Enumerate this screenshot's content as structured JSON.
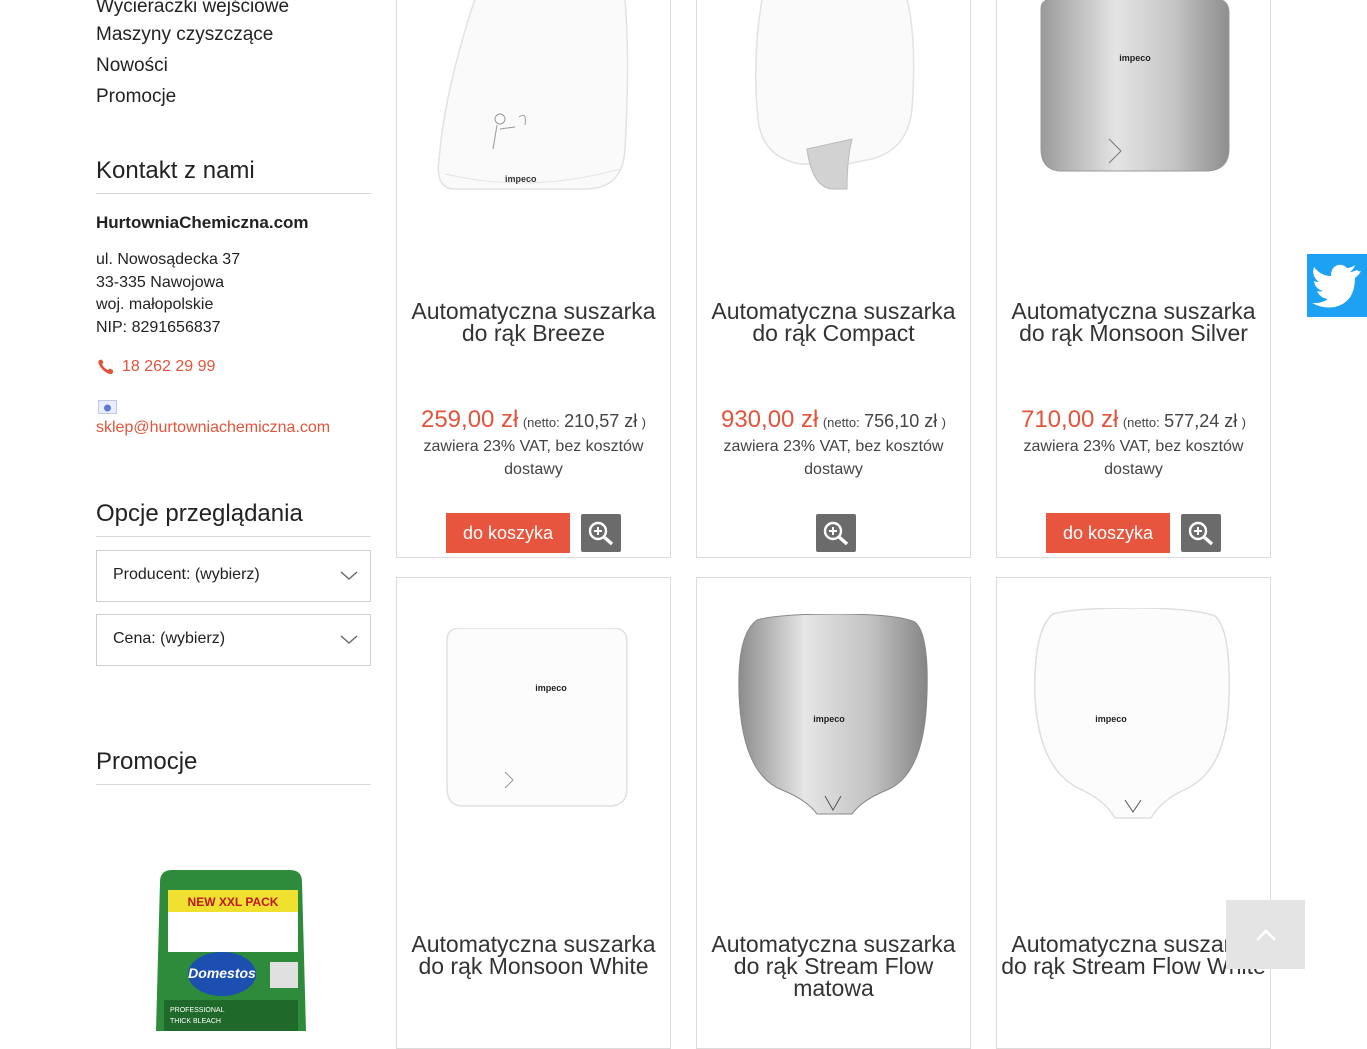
{
  "sidebar": {
    "links": [
      "Wycieraczki wejściowe",
      "Maszyny czyszczące",
      "Nowości",
      "Promocje"
    ],
    "contact": {
      "heading": "Kontakt z nami",
      "company": "HurtowniaChemiczna.com",
      "address1": "ul. Nowosądecka 37",
      "address2": "33-335 Nawojowa",
      "address3": "woj. małopolskie",
      "nip": "NIP: 8291656837",
      "phone": "18 262 29 99",
      "email": "sklep@hurtowniachemiczna.com"
    },
    "browse": {
      "heading": "Opcje przeglądania",
      "producer": "Producent: (wybierz)",
      "price": "Cena: (wybierz)"
    },
    "promo": {
      "heading": "Promocje",
      "product_brand": "Domestos",
      "badge": "NEW XXL PACK",
      "label_small": "PROFESSIONAL",
      "label_small2": "THICK BLEACH"
    }
  },
  "products": [
    {
      "title": "Automatyczna suszarka do rąk Breeze",
      "price": "259,00 zł",
      "netto_label": "(netto:",
      "netto": "210,57 zł",
      "close": ")",
      "vat": "zawiera 23% VAT, bez kosztów dostawy",
      "cart": "do koszyka",
      "brand": "impeco"
    },
    {
      "title": "Automatyczna suszarka do rąk Compact",
      "price": "930,00 zł",
      "netto_label": "(netto:",
      "netto": "756,10 zł",
      "close": ")",
      "vat": "zawiera 23% VAT, bez kosztów dostawy",
      "cart": "",
      "brand": ""
    },
    {
      "title": "Automatyczna suszarka do rąk Monsoon Silver",
      "price": "710,00 zł",
      "netto_label": "(netto:",
      "netto": "577,24 zł",
      "close": ")",
      "vat": "zawiera 23% VAT, bez kosztów dostawy",
      "cart": "do koszyka",
      "brand": "impeco"
    },
    {
      "title": "Automatyczna suszarka do rąk Monsoon White",
      "brand": "impeco"
    },
    {
      "title": "Automatyczna suszarka do rąk Stream Flow matowa",
      "brand": "impeco"
    },
    {
      "title": "Automatyczna suszarka do rąk Stream Flow White",
      "brand": "impeco"
    }
  ],
  "colors": {
    "accent": "#e8553f",
    "price": "#e2543c",
    "twitter": "#1da1f2"
  },
  "icons": {
    "zoom": "magnifier-plus-icon",
    "twitter": "twitter-bird-icon",
    "up": "chevron-up-icon",
    "phone": "phone-icon",
    "email": "email-icon"
  }
}
